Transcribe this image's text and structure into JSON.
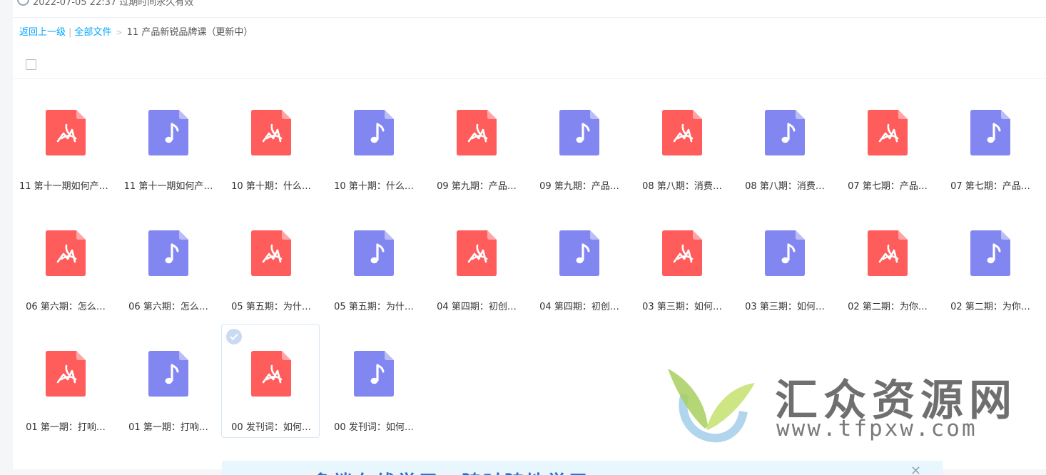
{
  "header": {
    "partial_text": "2022-07-05 22:37  过期时间永久有效"
  },
  "breadcrumb": {
    "back": "返回上一级",
    "divider": "|",
    "all_files": "全部文件",
    "arrow": ">",
    "current": "11 产品新锐品牌课（更新中）"
  },
  "files": [
    {
      "name": "11 第十一期如何产品…",
      "type": "pdf"
    },
    {
      "name": "11 第十一期如何产…",
      "type": "audio"
    },
    {
      "name": "10 第十期：什么…",
      "type": "pdf"
    },
    {
      "name": "10 第十期：什么…",
      "type": "audio"
    },
    {
      "name": "09 第九期：产品…",
      "type": "pdf"
    },
    {
      "name": "09 第九期：产品…",
      "type": "audio"
    },
    {
      "name": "08 第八期：消费…",
      "type": "pdf"
    },
    {
      "name": "08 第八期：消费…",
      "type": "audio"
    },
    {
      "name": "07 第七期：产品…",
      "type": "pdf"
    },
    {
      "name": "07 第七期：产品…",
      "type": "audio"
    },
    {
      "name": "06 第六期：怎么…",
      "type": "pdf"
    },
    {
      "name": "06 第六期：怎么…",
      "type": "audio"
    },
    {
      "name": "05 第五期：为什…",
      "type": "pdf"
    },
    {
      "name": "05 第五期：为什…",
      "type": "audio"
    },
    {
      "name": "04 第四期：初创…",
      "type": "pdf"
    },
    {
      "name": "04 第四期：初创…",
      "type": "audio"
    },
    {
      "name": "03 第三期：如何…",
      "type": "pdf"
    },
    {
      "name": "03 第三期：如何…",
      "type": "audio"
    },
    {
      "name": "02 第二期：为你…",
      "type": "pdf"
    },
    {
      "name": "02 第二期：为你…",
      "type": "audio"
    },
    {
      "name": "01 第一期：打响…",
      "type": "pdf"
    },
    {
      "name": "01 第一期：打响…",
      "type": "audio"
    },
    {
      "name": "00 发刊词：如何…",
      "type": "pdf",
      "selected": true
    },
    {
      "name": "00 发刊词：如何…",
      "type": "audio"
    }
  ],
  "watermark": {
    "title": "汇众资源网",
    "url": "www.tfpxw.com"
  },
  "ad": {
    "text": "多端在线学习，随时随地学习",
    "close": "✕"
  },
  "colors": {
    "pdf": "#ff5c5c",
    "audio": "#8286f0",
    "link": "#06a7ff"
  },
  "icons": {
    "pdf": "pdf-file-icon",
    "audio": "audio-file-icon",
    "check": "check-circle-icon"
  }
}
